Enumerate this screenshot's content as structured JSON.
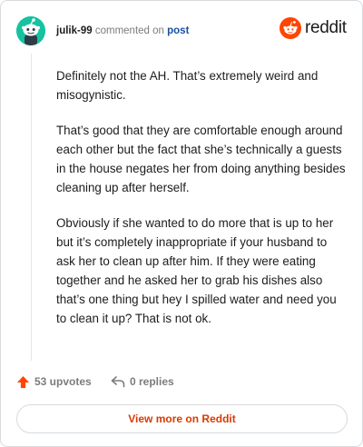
{
  "header": {
    "username": "julik-99",
    "action_text": "commented on",
    "post_link": "post",
    "brand": "reddit"
  },
  "comment": {
    "paragraphs": [
      "Definitely not the AH. That’s extremely weird and misogynistic.",
      "That’s good that they are comfortable enough around each other but the fact that she’s technically a guests in the house negates her from doing anything besides cleaning up after herself.",
      "Obviously if she wanted to do more that is up to her but it’s completely inappropriate if your husband to ask her to clean up after him. If they were eating together and he asked her to grab his dishes also that’s one thing but hey I spilled water and need you to clean it up? That is not ok."
    ]
  },
  "actions": {
    "upvotes_label": "53 upvotes",
    "replies_label": "0 replies"
  },
  "footer": {
    "view_more_label": "View more on Reddit"
  },
  "colors": {
    "accent": "#d93a00",
    "avatar": "#16c2a0",
    "link": "#1a4fa0",
    "upvote": "#ff4500"
  }
}
